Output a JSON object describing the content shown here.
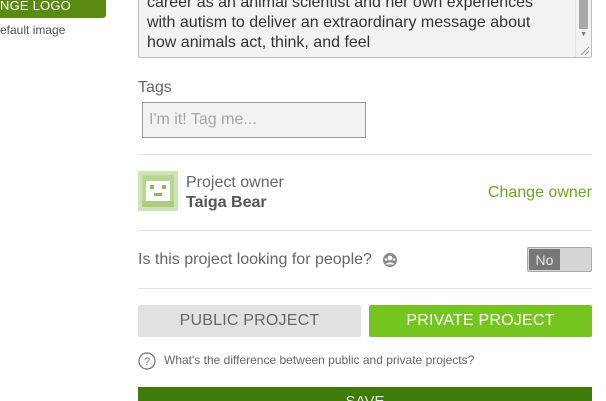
{
  "sidebar": {
    "change_logo_label": "NGE LOGO",
    "default_image_label": "efault image"
  },
  "description": {
    "lines": [
      "career as an animal scientist and her own experiences",
      "with autism to deliver an extraordinary message about",
      "how animals act, think, and feel"
    ]
  },
  "tags": {
    "label": "Tags",
    "placeholder": "I'm it! Tag me..."
  },
  "owner": {
    "caption": "Project owner",
    "name": "Taiga Bear",
    "change_label": "Change owner"
  },
  "looking_for_people": {
    "label": "Is this project looking for people?",
    "toggle_value": "No"
  },
  "visibility": {
    "public_label": "PUBLIC PROJECT",
    "private_label": "PRIVATE PROJECT",
    "selected": "private",
    "help_text": "What's the difference between public and private projects?"
  },
  "save": {
    "label": "SAVE"
  },
  "colors": {
    "accent_green": "#76c41f",
    "dark_green": "#3f7a0a",
    "link_green": "#6aa81d"
  },
  "icons": {
    "looking": "people-group-icon",
    "help": "question-circle-icon",
    "avatar": "owner-avatar"
  }
}
